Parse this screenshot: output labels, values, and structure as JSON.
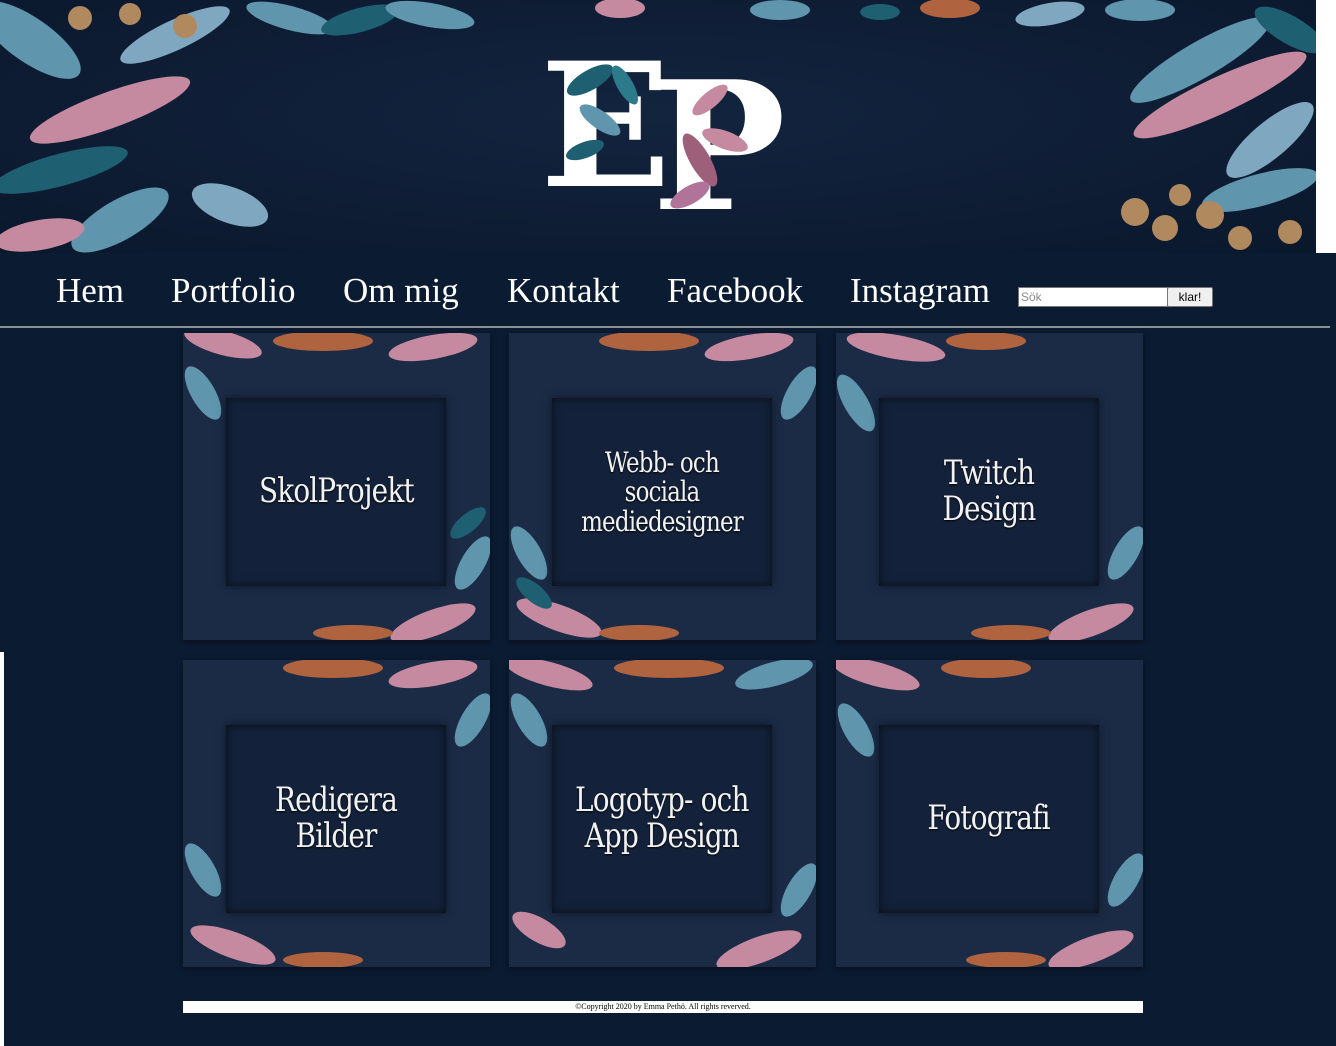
{
  "logo": {
    "letter_1": "E",
    "letter_2": "P"
  },
  "nav": {
    "links": [
      "Hem",
      "Portfolio",
      "Om mig",
      "Kontakt",
      "Facebook",
      "Instagram"
    ]
  },
  "search": {
    "placeholder": "Sök",
    "button_label": "klar!"
  },
  "tiles": [
    {
      "label": "SkolProjekt"
    },
    {
      "label": "Webb- och\nsociala mediedesigner"
    },
    {
      "label": "Twitch Design"
    },
    {
      "label": "Redigera Bilder"
    },
    {
      "label": "Logotyp- och\nApp Design"
    },
    {
      "label": "Fotografi"
    }
  ],
  "footer": {
    "text": "©Copyright 2020 by Emma Pethö. All rights reverved."
  },
  "colors": {
    "background": "#0b1b32",
    "tile": "#1b2b46",
    "leaf_pink": "#c58aa0",
    "leaf_blue": "#5f96ad",
    "leaf_teal": "#1e5f72",
    "leaf_copper": "#b0633f"
  }
}
